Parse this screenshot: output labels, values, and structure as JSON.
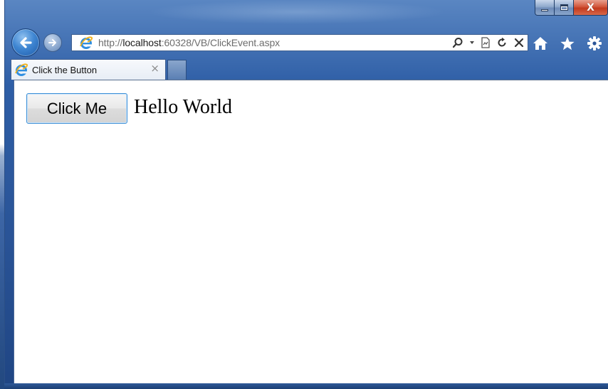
{
  "window": {
    "buttons": {
      "minimize": "minimize",
      "maximize": "maximize",
      "close": "X"
    }
  },
  "navigation": {
    "back_icon": "back-arrow-icon",
    "forward_icon": "forward-arrow-icon"
  },
  "address_bar": {
    "url_prefix": "http://",
    "url_host": "localhost",
    "url_rest": ":60328/VB/ClickEvent.aspx",
    "tools": [
      "search-icon",
      "dropdown-icon",
      "compatibility-view-icon",
      "refresh-icon",
      "stop-icon"
    ]
  },
  "command_bar": {
    "icons": [
      "home-icon",
      "favorites-star-icon",
      "tools-gear-icon"
    ]
  },
  "tab": {
    "title": "Click the Button",
    "close_glyph": "×"
  },
  "page": {
    "button_label": "Click Me",
    "label_text": "Hello World"
  },
  "colors": {
    "frame": "#2e5ea6",
    "button_border": "#3c8fd6",
    "close_button": "#c23a1e"
  }
}
